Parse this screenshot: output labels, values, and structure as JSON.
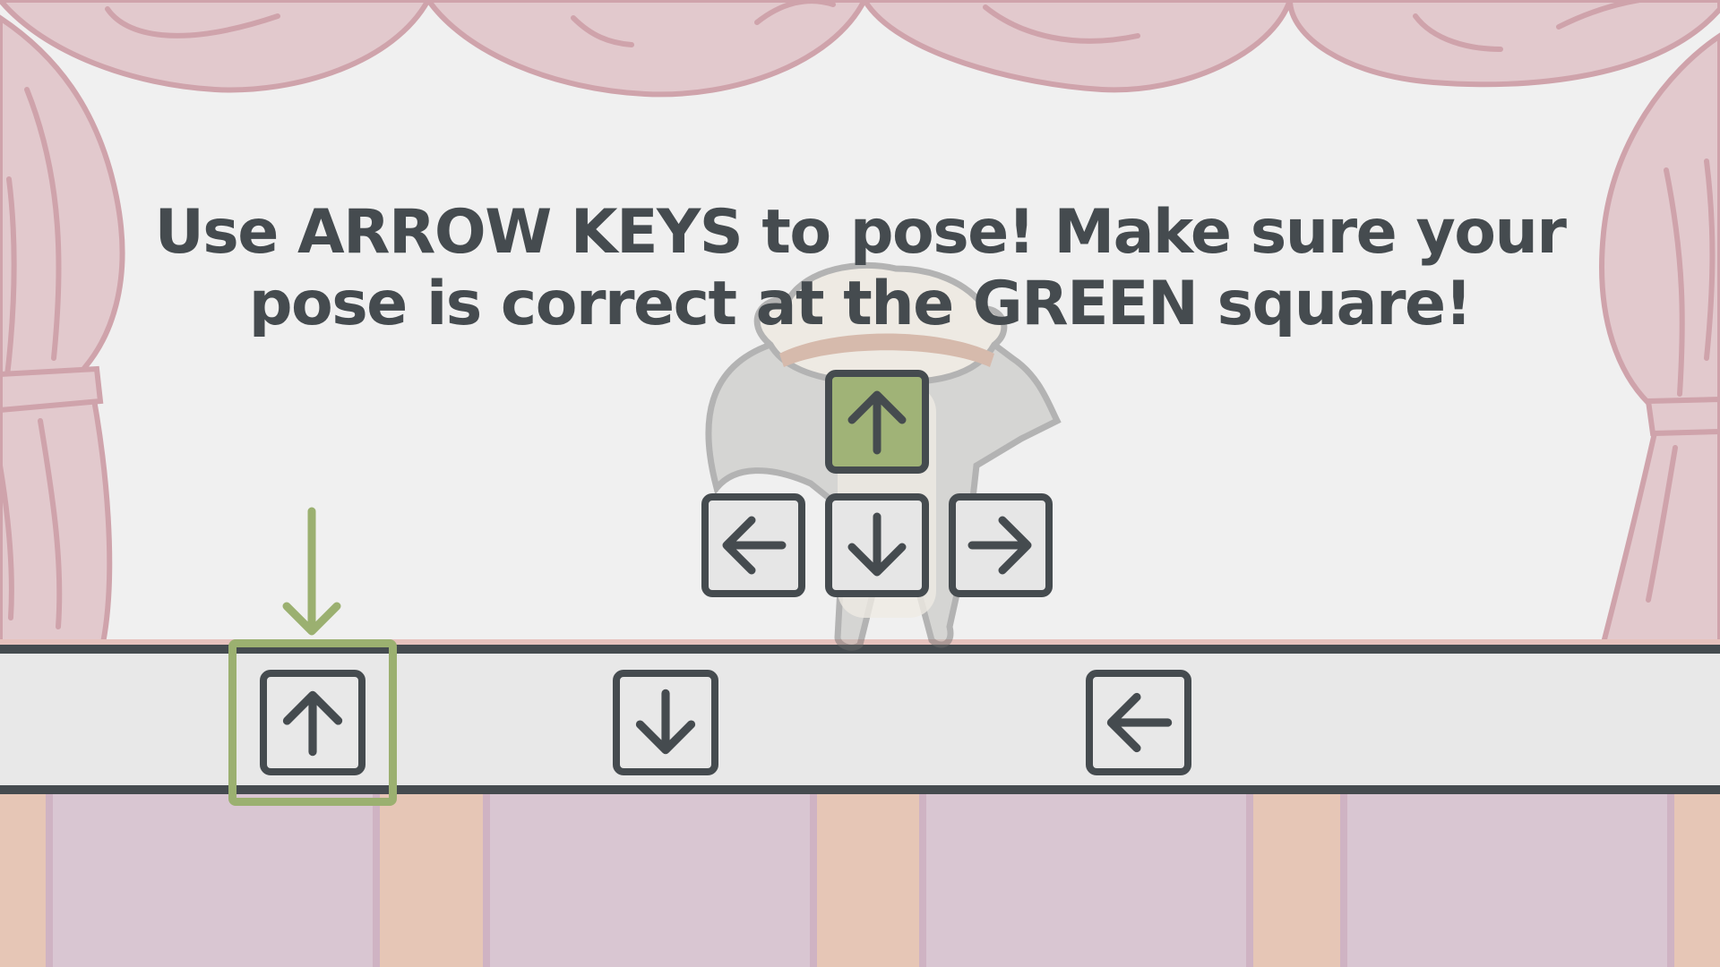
{
  "instruction": {
    "line1": "Use ARROW KEYS to pose! Make sure your",
    "line2": "pose is correct at the GREEN square!"
  },
  "pose_keys": [
    {
      "id": "up",
      "icon": "arrow-up-icon",
      "active": true
    },
    {
      "id": "left",
      "icon": "arrow-left-icon",
      "active": false
    },
    {
      "id": "down",
      "icon": "arrow-down-icon",
      "active": false
    },
    {
      "id": "right",
      "icon": "arrow-right-icon",
      "active": false
    }
  ],
  "lane_notes": [
    {
      "id": "note-1",
      "icon": "arrow-up-icon",
      "in_target": true
    },
    {
      "id": "note-2",
      "icon": "arrow-down-icon",
      "in_target": false
    },
    {
      "id": "note-3",
      "icon": "arrow-left-icon",
      "in_target": false
    }
  ],
  "colors": {
    "accent_green": "#9bb070",
    "key_outline": "#454b4f",
    "curtain": "#e2c9cd",
    "curtain_line": "#cfa3ab",
    "stage_front_purple": "#d9c6d2",
    "stage_front_tan": "#e6c6b6"
  }
}
